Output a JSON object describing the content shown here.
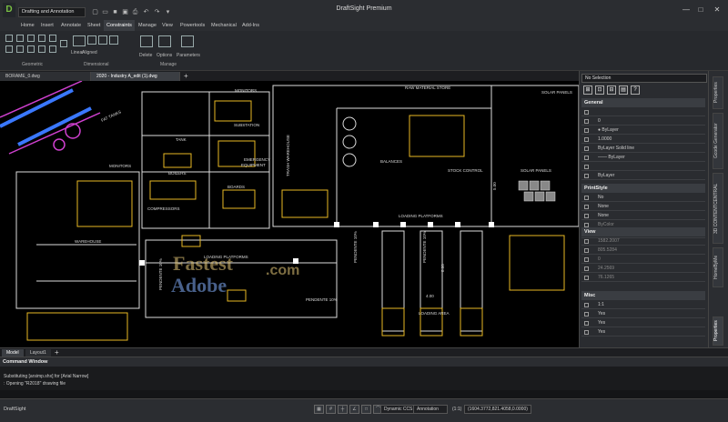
{
  "app": {
    "title": "DraftSight Premium",
    "logo": "D",
    "workspace": "Drafting and Annotation"
  },
  "menu": [
    "Home",
    "Insert",
    "Annotate",
    "Sheet",
    "Constraints",
    "Manage",
    "View",
    "Powertools",
    "Mechanical",
    "Add-Ins"
  ],
  "menu_active": "Constraints",
  "ribbon": {
    "labels": {
      "linear": "Linear",
      "aligned": "Aligned",
      "delete": "Delete",
      "options": "Options",
      "parameters": "Parameters"
    },
    "groups": {
      "geometric": "Geometric",
      "dimensional": "Dimensional",
      "manage": "Manage"
    }
  },
  "doc_tabs": [
    "BORAME_0.dwg",
    "2020 - Industry A_edit (1).dwg"
  ],
  "doc_tab_new": "+",
  "drawing_labels": {
    "raw_material_store": "RAW MATERIAL STORE",
    "solar_panels_top": "SOLAR PANELS",
    "solar_panels_right": "SOLAR PANELS",
    "balances": "BALANCES",
    "stock_control": "STOCK CONTROL",
    "loading_platforms_center": "LOADING PLATFORMS",
    "loading_platforms_lower": "LOADING PLATFORMS",
    "loading_area": "LOADING AREA",
    "tank": "TANK",
    "substation": "SUBSTATION",
    "emergency_equipment_1": "EMERGENCY",
    "emergency_equipment_2": "EQUIPMENT",
    "boilers": "BOILERS",
    "boards": "BOARDS",
    "compressors": "COMPRESSORS",
    "monitors_top": "MONITORS",
    "monitors_left": "MONITORS",
    "warehouse": "WAREHOUSE",
    "trash_warehouse": "TRASH WAREHOUSE",
    "fat_tanks": "FAT TANKS",
    "dim_500": "5.00",
    "dim_800": "8.00",
    "dim_400": "4.00",
    "pendente_1": "PENDENTE 10%",
    "pendente_2": "PENDENTE 10%",
    "pendente_3": "PENDENTE 10%",
    "pendente_4": "PENDENTE 10%"
  },
  "panel": {
    "selection": "No Selection",
    "general_title": "General",
    "general_rows": [
      {
        "icon": "color-icon",
        "value": ""
      },
      {
        "icon": "layer-icon",
        "value": "0"
      },
      {
        "icon": "linetype-icon",
        "value": "● ByLayer"
      },
      {
        "icon": "scale-icon",
        "value": "1.0000"
      },
      {
        "icon": "lineweight-icon",
        "value": "ByLayer    Solid line"
      },
      {
        "icon": "lineweight2-icon",
        "value": "——  ByLayer"
      },
      {
        "icon": "thickness-icon",
        "value": ""
      },
      {
        "icon": "transparency-icon",
        "value": "ByLayer"
      }
    ],
    "printstyle_title": "PrintStyle",
    "printstyle_rows": [
      {
        "icon": "print-icon",
        "value": "No"
      },
      {
        "icon": "style-icon",
        "value": "None"
      },
      {
        "icon": "table-icon",
        "value": "None"
      },
      {
        "icon": "color2-icon",
        "value": "ByColor"
      },
      {
        "icon": "print2-icon",
        "value": ""
      }
    ],
    "view_title": "View",
    "view_rows": [
      {
        "icon": "x-icon",
        "value": "1582.2007"
      },
      {
        "icon": "y-icon",
        "value": "805.5284"
      },
      {
        "icon": "z-icon",
        "value": "0"
      },
      {
        "icon": "height-icon",
        "value": "24.2569"
      },
      {
        "icon": "width-icon",
        "value": "76.1265"
      }
    ],
    "misc_title": "Misc",
    "misc_rows": [
      {
        "icon": "scale2-icon",
        "value": "1:1"
      },
      {
        "icon": "ucs-icon",
        "value": "Yes"
      },
      {
        "icon": "ucs2-icon",
        "value": "Yes"
      },
      {
        "icon": "ucs3-icon",
        "value": "Yes"
      }
    ]
  },
  "side_tabs": [
    "Properties",
    "Gcode Generator",
    "3D CONTENTCENTRAL",
    "HomeByMe"
  ],
  "layout_tabs": [
    "Model",
    "Layout1"
  ],
  "layout_tab_new": "+",
  "command_window": {
    "title": "Command Window",
    "lines": [
      "Substituting [arsimp.shx] for [Arial Narrow]",
      ": Opening \"R2018\" drawing file"
    ]
  },
  "status": {
    "app_label": "DraftSight",
    "dynamic_ccs": "Dynamic CCS",
    "annotation": "Annotation",
    "scale": "(1:1)",
    "coords": "(1604.3772,821.4058,0.0000)"
  },
  "watermark": {
    "line1": "Fastest",
    "line2": "Adobe",
    "suffix": ".com"
  },
  "colors": {
    "cad_yellow": "#e8b923",
    "cad_white": "#dcdcdc",
    "cad_blue": "#3a78ff",
    "cad_magenta": "#d040d0",
    "panel_bg": "#2a2c30"
  }
}
